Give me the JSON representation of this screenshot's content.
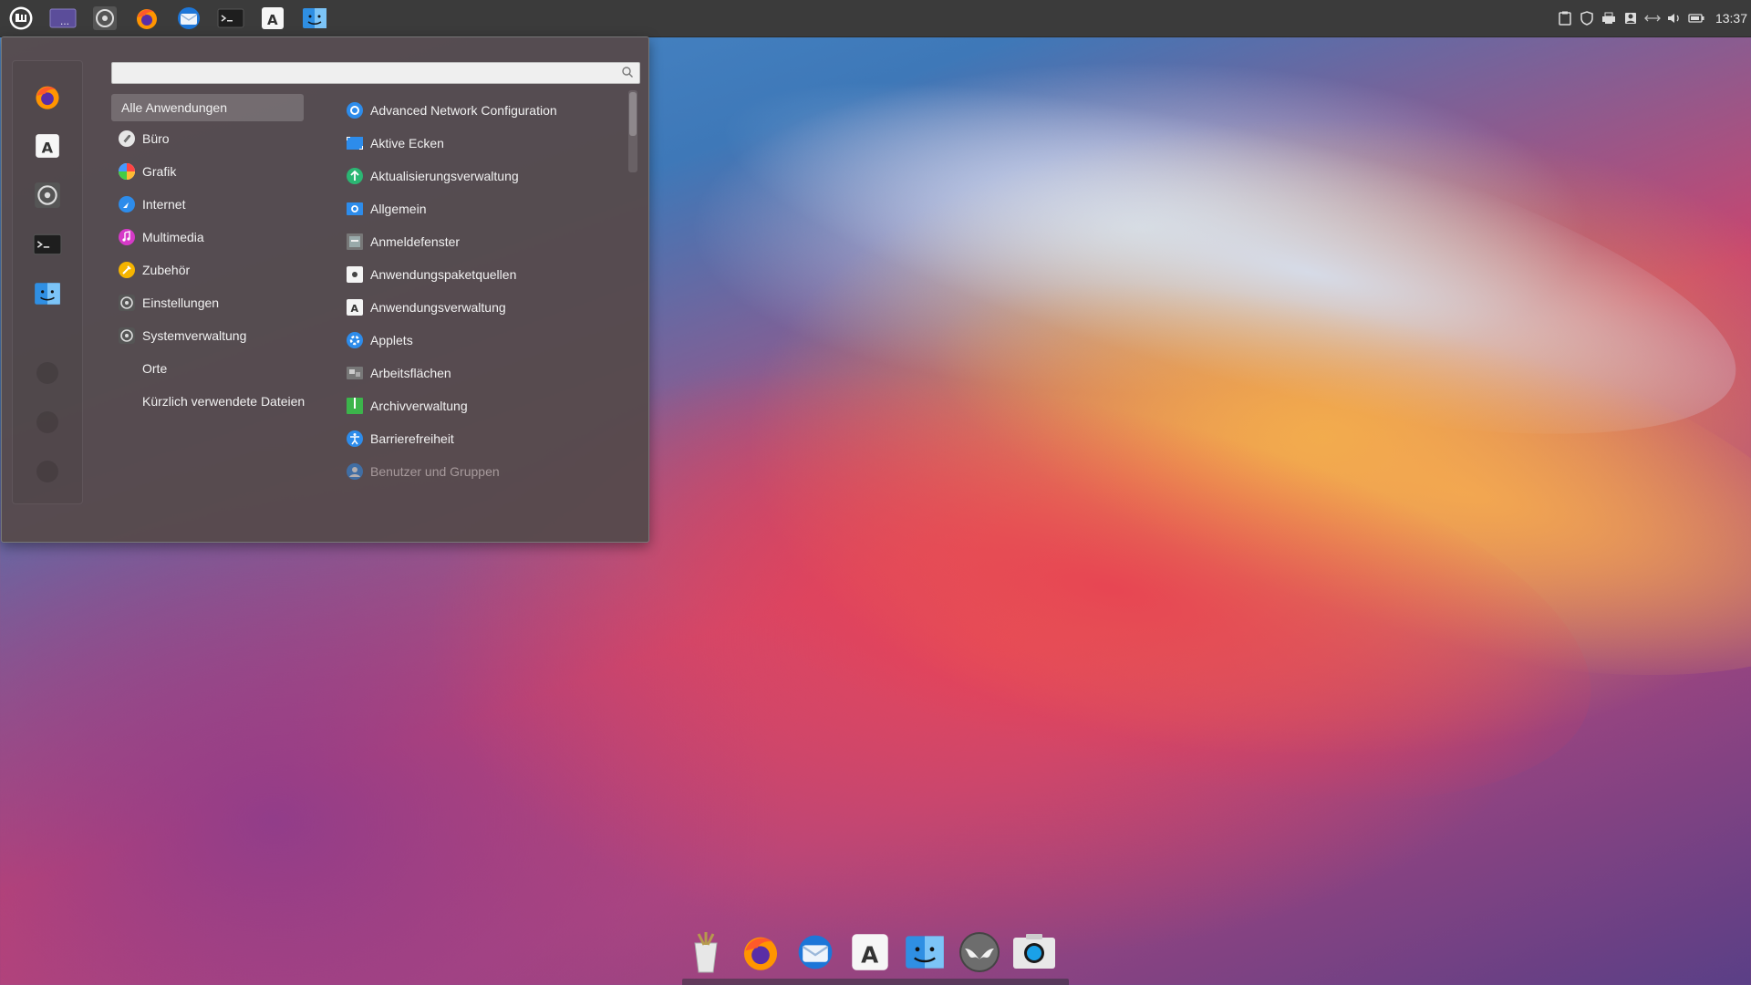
{
  "top_panel": {
    "launchers": [
      {
        "name": "linux-mint-menu-icon"
      },
      {
        "name": "workspace-switcher-icon"
      },
      {
        "name": "system-settings-icon"
      },
      {
        "name": "firefox-icon"
      },
      {
        "name": "thunderbird-icon"
      },
      {
        "name": "terminal-icon"
      },
      {
        "name": "software-manager-icon"
      },
      {
        "name": "file-manager-icon"
      }
    ],
    "tray": [
      "clipboard-icon",
      "shield-icon",
      "printer-icon",
      "user-icon",
      "network-icon",
      "volume-icon",
      "battery-icon"
    ],
    "clock": "13:37"
  },
  "menu": {
    "search": {
      "value": "",
      "placeholder": ""
    },
    "categories": [
      {
        "label": "Alle Anwendungen",
        "icon": ""
      },
      {
        "label": "Büro",
        "icon": "office-icon"
      },
      {
        "label": "Grafik",
        "icon": "graphics-icon"
      },
      {
        "label": "Internet",
        "icon": "internet-icon"
      },
      {
        "label": "Multimedia",
        "icon": "multimedia-icon"
      },
      {
        "label": "Zubehör",
        "icon": "accessories-icon"
      },
      {
        "label": "Einstellungen",
        "icon": "preferences-icon"
      },
      {
        "label": "Systemverwaltung",
        "icon": "administration-icon"
      },
      {
        "label": "Orte",
        "icon": ""
      },
      {
        "label": "Kürzlich verwendete Dateien",
        "icon": ""
      }
    ],
    "apps": [
      {
        "label": "Advanced Network Configuration",
        "icon": "network-config-icon"
      },
      {
        "label": "Aktive Ecken",
        "icon": "hot-corners-icon"
      },
      {
        "label": "Aktualisierungsverwaltung",
        "icon": "update-manager-icon"
      },
      {
        "label": "Allgemein",
        "icon": "general-settings-icon"
      },
      {
        "label": "Anmeldefenster",
        "icon": "login-window-icon"
      },
      {
        "label": "Anwendungspaketquellen",
        "icon": "software-sources-icon"
      },
      {
        "label": "Anwendungsverwaltung",
        "icon": "software-manager-icon"
      },
      {
        "label": "Applets",
        "icon": "applets-icon"
      },
      {
        "label": "Arbeitsflächen",
        "icon": "workspaces-icon"
      },
      {
        "label": "Archivverwaltung",
        "icon": "archive-manager-icon"
      },
      {
        "label": "Barrierefreiheit",
        "icon": "accessibility-icon"
      },
      {
        "label": "Benutzer und Gruppen",
        "icon": "users-groups-icon"
      }
    ]
  },
  "dock": [
    "cleaner-icon",
    "firefox-icon",
    "thunderbird-icon",
    "software-manager-icon",
    "file-manager-icon",
    "bat-icon",
    "screenshot-icon"
  ]
}
